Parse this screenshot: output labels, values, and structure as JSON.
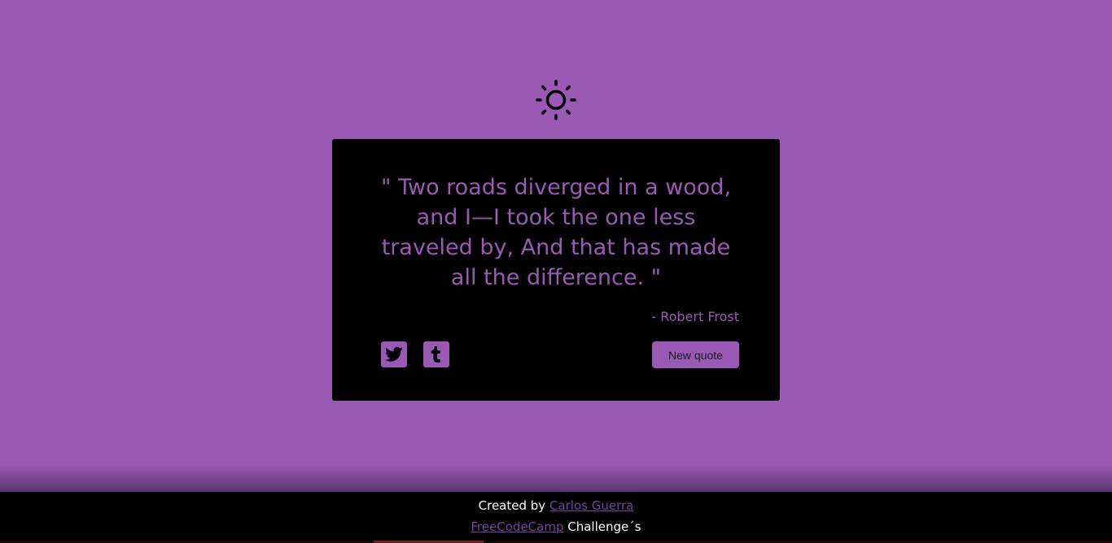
{
  "theme_toggle": {
    "icon": "sun-icon"
  },
  "quote": {
    "text": "\" Two roads diverged in a wood, and I—I took the one less traveled by, And that has made all the difference. \"",
    "author": "- Robert Frost"
  },
  "actions": {
    "twitter_icon": "twitter-icon",
    "tumblr_icon": "tumblr-icon",
    "new_quote_label": "New quote"
  },
  "footer": {
    "created_by": "Created by",
    "author_link": "Carlos Guerra",
    "fcc_link": "FreeCodeCamp",
    "challenge_text": "Challenge´s"
  },
  "colors": {
    "background": "#9b59b6",
    "card": "#000000",
    "accent": "#9b59b6",
    "link": "#7b3fa0"
  }
}
